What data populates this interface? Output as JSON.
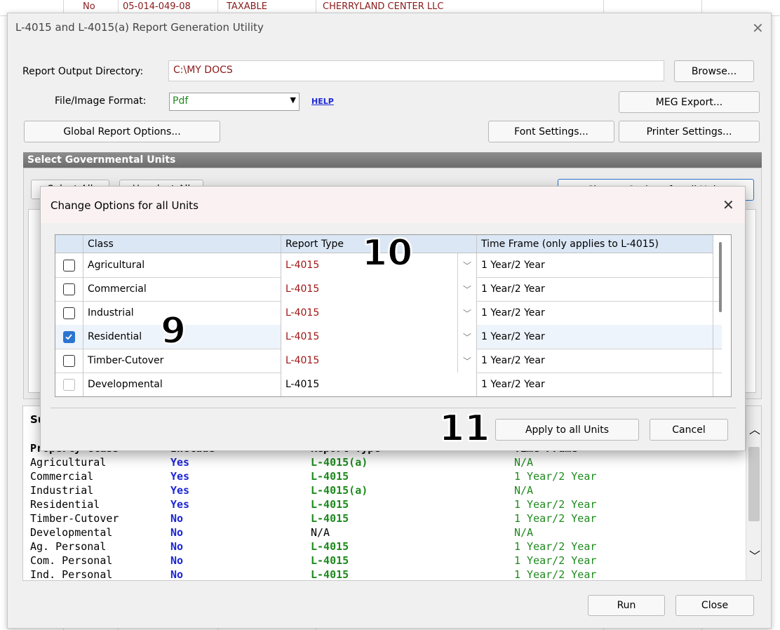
{
  "background": {
    "row_no": "No",
    "row_id": "05-014-049-08",
    "row_status": "TAXABLE",
    "row_owner": "CHERRYLAND CENTER LLC"
  },
  "window": {
    "title": "L-4015 and L-4015(a) Report Generation Utility",
    "output_dir_label": "Report Output Directory:",
    "output_dir_value": "C:\\MY DOCS",
    "browse_label": "Browse...",
    "format_label": "File/Image Format:",
    "format_value": "Pdf",
    "help_label": "HELP",
    "meg_export_label": "MEG Export...",
    "global_options_label": "Global Report Options...",
    "font_settings_label": "Font Settings...",
    "printer_settings_label": "Printer Settings...",
    "section_title": "Select Governmental Units",
    "select_all_label": "Select All",
    "unselect_all_label": "Unselect All",
    "change_options_label": "Change Options for all Units",
    "run_label": "Run",
    "close_label": "Close"
  },
  "summary": {
    "title": "Summary",
    "headers": [
      "Property Class",
      "Include",
      "Report Type",
      "Time Frame"
    ],
    "rows": [
      [
        "Agricultural",
        "Yes",
        "L-4015(a)",
        "N/A"
      ],
      [
        "Commercial",
        "Yes",
        "L-4015",
        "1 Year/2 Year"
      ],
      [
        "Industrial",
        "Yes",
        "L-4015(a)",
        "N/A"
      ],
      [
        "Residential",
        "Yes",
        "L-4015",
        "1 Year/2 Year"
      ],
      [
        "Timber-Cutover",
        "No",
        "L-4015",
        "1 Year/2 Year"
      ],
      [
        "Developmental",
        "No",
        "N/A",
        "N/A"
      ],
      [
        "Ag. Personal",
        "No",
        "L-4015",
        "1 Year/2 Year"
      ],
      [
        "Com. Personal",
        "No",
        "L-4015",
        "1 Year/2 Year"
      ],
      [
        "Ind. Personal",
        "No",
        "L-4015",
        "1 Year/2 Year"
      ]
    ]
  },
  "dialog": {
    "title": "Change Options for all Units",
    "columns": [
      "Class",
      "Report Type",
      "Time Frame (only applies to L-4015)"
    ],
    "rows": [
      {
        "class": "Agricultural",
        "checked": false,
        "report_type": "L-4015",
        "time_frame": "1 Year/2 Year"
      },
      {
        "class": "Commercial",
        "checked": false,
        "report_type": "L-4015",
        "time_frame": "1 Year/2 Year"
      },
      {
        "class": "Industrial",
        "checked": false,
        "report_type": "L-4015",
        "time_frame": "1 Year/2 Year"
      },
      {
        "class": "Residential",
        "checked": true,
        "report_type": "L-4015",
        "time_frame": "1 Year/2 Year"
      },
      {
        "class": "Timber-Cutover",
        "checked": false,
        "report_type": "L-4015",
        "time_frame": "1 Year/2 Year"
      },
      {
        "class": "Developmental",
        "checked": false,
        "report_type": "L-4015",
        "time_frame": "1 Year/2 Year"
      }
    ],
    "apply_label": "Apply to all Units",
    "cancel_label": "Cancel"
  },
  "annotations": {
    "label_9": "9",
    "label_10": "10",
    "label_11": "11"
  },
  "colors": {
    "accent_blue": "#2b74d1",
    "red_text": "#a01515",
    "green_text": "#1e8a1e",
    "blue_text": "#1c26d6",
    "header_blue": "#dbe7f5"
  }
}
